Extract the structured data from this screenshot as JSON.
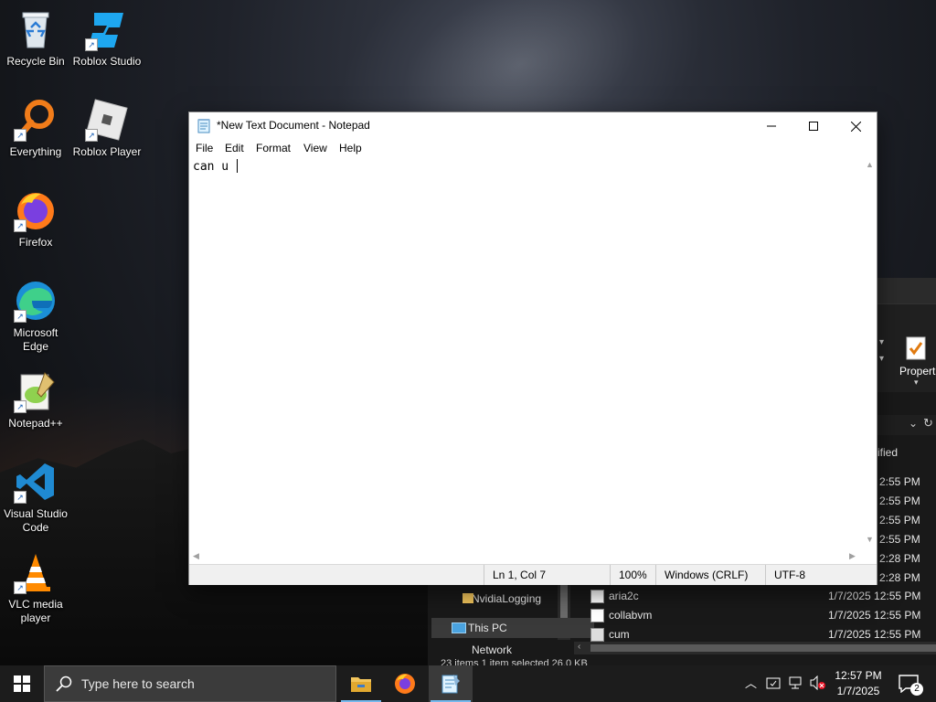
{
  "desktop": {
    "icons": [
      {
        "label": "Recycle Bin"
      },
      {
        "label": "Roblox Studio"
      },
      {
        "label": "Everything"
      },
      {
        "label": "Roblox Player"
      },
      {
        "label": "Firefox"
      },
      {
        "label": "Microsoft Edge"
      },
      {
        "label": "Notepad++"
      },
      {
        "label": "Visual Studio Code"
      },
      {
        "label": "VLC media player"
      }
    ]
  },
  "explorer": {
    "ribbon_label": "Propert",
    "column_header_fragment": "ified",
    "times": [
      "2:55 PM",
      "2:55 PM",
      "2:55 PM",
      "2:55 PM",
      "2:28 PM",
      "2:28 PM"
    ],
    "nav": [
      {
        "label": "NvidiaLogging"
      },
      {
        "label": "This PC"
      },
      {
        "label": "Network"
      }
    ],
    "files": [
      {
        "name": "aria2c",
        "date": "1/7/2025 12:55 PM"
      },
      {
        "name": "collabvm",
        "date": "1/7/2025 12:55 PM"
      },
      {
        "name": "cum",
        "date": "1/7/2025 12:55 PM"
      }
    ],
    "status": "23 items    1 item selected  26.0 KB"
  },
  "notepad": {
    "title": "*New Text Document - Notepad",
    "menu": [
      "File",
      "Edit",
      "Format",
      "View",
      "Help"
    ],
    "content": "can u ",
    "status": {
      "position": "Ln 1, Col 7",
      "zoom": "100%",
      "line_ending": "Windows (CRLF)",
      "encoding": "UTF-8"
    }
  },
  "taskbar": {
    "search_placeholder": "Type here to search",
    "time": "12:57 PM",
    "date": "1/7/2025",
    "notification_count": "2"
  }
}
